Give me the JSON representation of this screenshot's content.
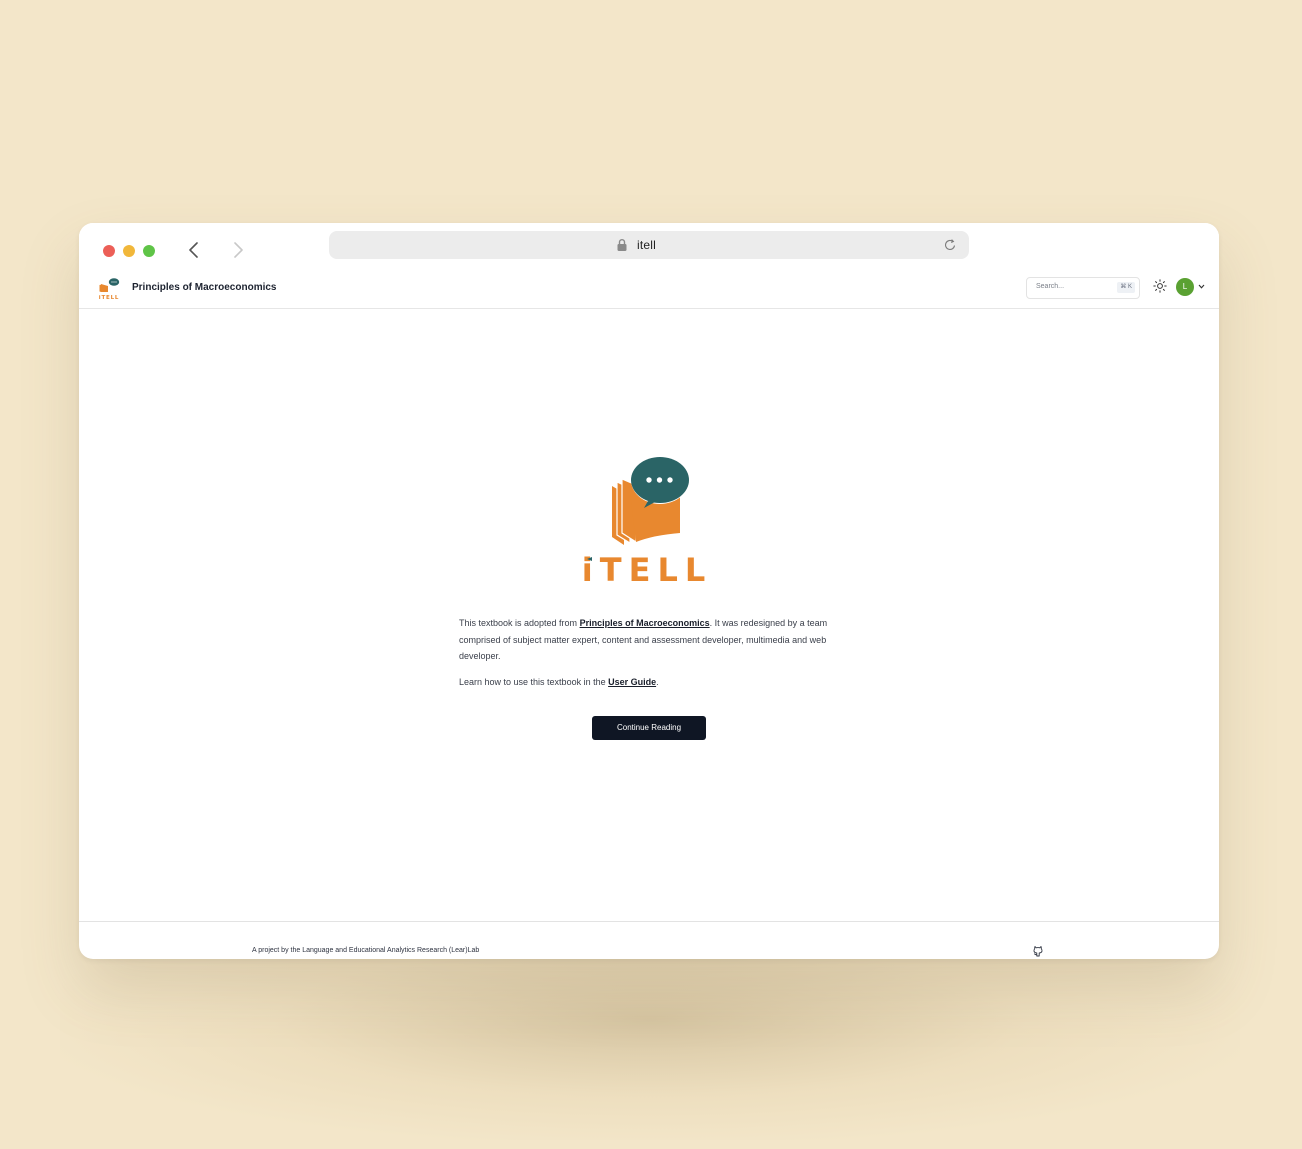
{
  "browser": {
    "url": "itell"
  },
  "appbar": {
    "book_title": "Principles of Macroeconomics",
    "search_placeholder": "Search...",
    "search_shortcut": "⌘ K",
    "avatar_initial": "L"
  },
  "hero": {
    "brand_name": "iTELL",
    "intro_prefix": "This textbook is adopted from ",
    "intro_link": "Principles of Macroeconomics",
    "intro_suffix": ". It was redesigned by a team comprised of subject matter expert, content and assessment developer, multimedia and web developer.",
    "guide_prefix": "Learn how to use this textbook in the ",
    "guide_link": "User Guide",
    "guide_suffix": ".",
    "cta_label": "Continue Reading"
  },
  "footer": {
    "credit": "A project by the Language and Educational Analytics Research (Lear)Lab"
  },
  "colors": {
    "background": "#f3e6c9",
    "brand_orange": "#e8882f",
    "brand_teal": "#2a6466",
    "cta": "#0f1624",
    "avatar": "#5aa132"
  },
  "icons": [
    "lock-icon",
    "reload-icon",
    "chevron-left-icon",
    "chevron-right-icon",
    "sun-icon",
    "chevron-down-icon",
    "github-icon"
  ]
}
